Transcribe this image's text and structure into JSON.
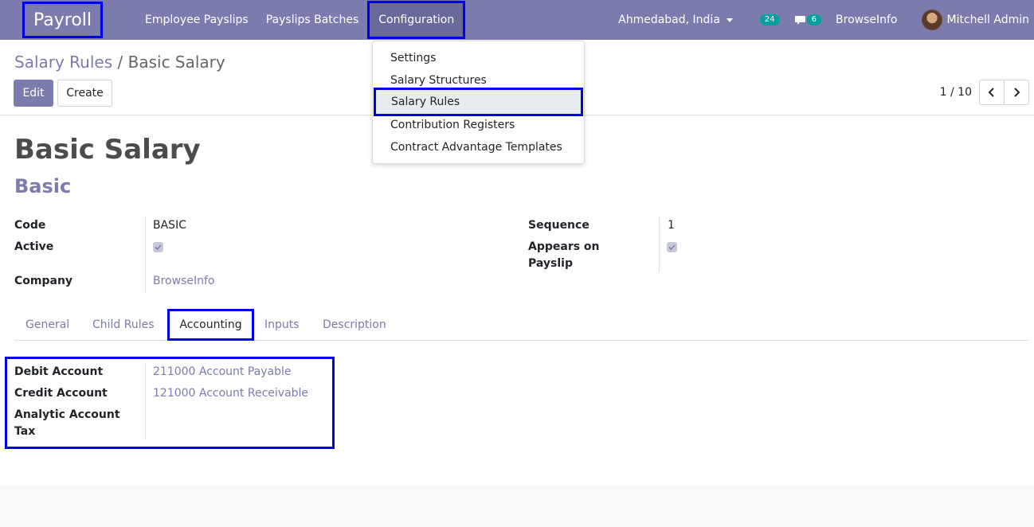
{
  "navbar": {
    "brand": "Payroll",
    "menu": [
      "Employee Payslips",
      "Payslips Batches",
      "Configuration"
    ],
    "company": "Ahmedabad, India",
    "activity_count": "24",
    "message_count": "6",
    "browseinfo": "BrowseInfo",
    "user": "Mitchell Admin"
  },
  "breadcrumb": {
    "parent": "Salary Rules",
    "separator": "/",
    "current": "Basic Salary"
  },
  "buttons": {
    "edit": "Edit",
    "create": "Create"
  },
  "pager": {
    "value": "1 / 10"
  },
  "form": {
    "name": "Basic Salary",
    "category": "Basic",
    "fields": {
      "code_label": "Code",
      "code_value": "BASIC",
      "active_label": "Active",
      "active_checked": true,
      "company_label": "Company",
      "company_value": "BrowseInfo",
      "sequence_label": "Sequence",
      "sequence_value": "1",
      "appears_label": "Appears on Payslip",
      "appears_checked": true
    },
    "tabs": [
      "General",
      "Child Rules",
      "Accounting",
      "Inputs",
      "Description"
    ],
    "active_tab": "Accounting",
    "accounting": {
      "debit_label": "Debit Account",
      "debit_value": "211000 Account Payable",
      "credit_label": "Credit Account",
      "credit_value": "121000 Account Receivable",
      "analytic_label": "Analytic Account Tax"
    }
  },
  "dropdown": {
    "items": [
      "Settings",
      "Salary Structures",
      "Salary Rules",
      "Contribution Registers",
      "Contract Advantage Templates"
    ],
    "selected": "Salary Rules"
  },
  "colors": {
    "navbar": "#7c7bad",
    "highlight": "#0000e6",
    "badge": "#00a09d"
  }
}
